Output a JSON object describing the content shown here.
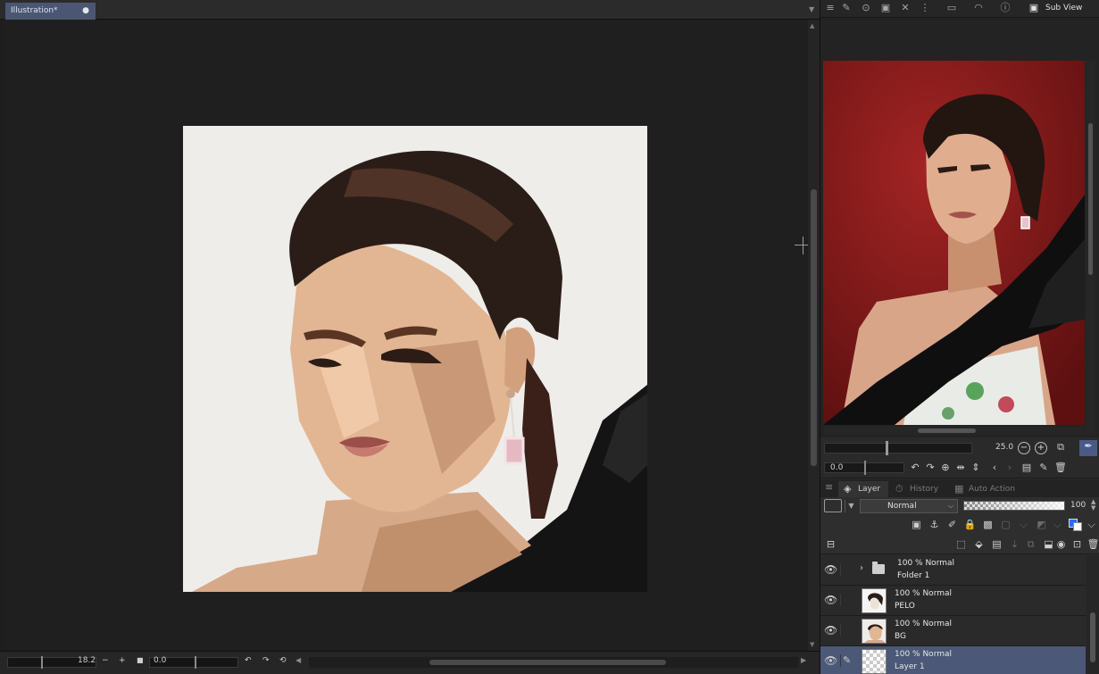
{
  "document_tab": {
    "title": "Illustration*",
    "close_symbol": "●"
  },
  "canvas_status": {
    "zoom": "18.2",
    "zoom_out_symbol": "−",
    "zoom_in_symbol": "+",
    "rotation": "0.0"
  },
  "subview": {
    "label": "Sub View",
    "zoom": "25.0",
    "rotation": "0.0",
    "accent_color": "#4a5a86"
  },
  "layer_palette": {
    "tabs": [
      {
        "label": "Layer",
        "icon": "layer-stack-icon",
        "active": true
      },
      {
        "label": "History",
        "icon": "history-icon",
        "active": false
      },
      {
        "label": "Auto Action",
        "icon": "auto-action-icon",
        "active": false
      }
    ],
    "blend_mode": "Normal",
    "opacity": "100",
    "opacity_fraction": 1.0,
    "layers": [
      {
        "mode": "100 % Normal",
        "name": "Folder 1",
        "type": "folder",
        "selected": false
      },
      {
        "mode": "100 % Normal",
        "name": "PELO",
        "type": "raster",
        "selected": false
      },
      {
        "mode": "100 % Normal",
        "name": "BG",
        "type": "raster",
        "selected": false
      },
      {
        "mode": "100 % Normal",
        "name": "Layer 1",
        "type": "raster",
        "selected": true
      }
    ],
    "selection_color": "#4b5877",
    "draw_color": "#2a69ff"
  }
}
